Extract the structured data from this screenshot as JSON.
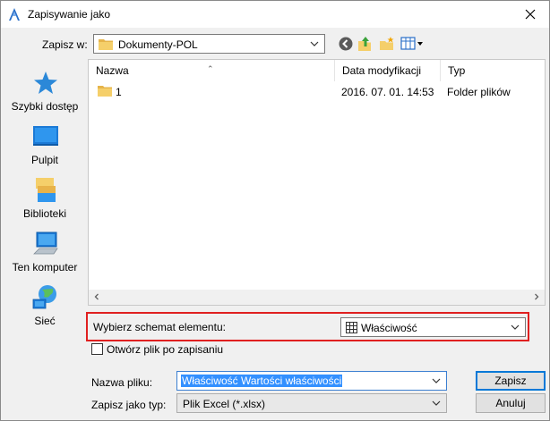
{
  "window": {
    "title": "Zapisywanie jako"
  },
  "toolbar": {
    "save_in_label": "Zapisz w:",
    "current_folder": "Dokumenty-POL"
  },
  "places": [
    {
      "label": "Szybki dostęp",
      "icon": "star-icon"
    },
    {
      "label": "Pulpit",
      "icon": "desktop-icon"
    },
    {
      "label": "Biblioteki",
      "icon": "libraries-icon"
    },
    {
      "label": "Ten komputer",
      "icon": "computer-icon"
    },
    {
      "label": "Sieć",
      "icon": "network-icon"
    }
  ],
  "file_list": {
    "columns": [
      "Nazwa",
      "Data modyfikacji",
      "Typ"
    ],
    "rows": [
      {
        "name": "1",
        "modified": "2016. 07. 01. 14:53",
        "type": "Folder plików"
      }
    ]
  },
  "schema": {
    "label": "Wybierz schemat elementu:",
    "selected": "Właściwość"
  },
  "open_after_save": {
    "label": "Otwórz plik po zapisaniu",
    "checked": false
  },
  "file_name": {
    "label": "Nazwa pliku:",
    "value": "Właściwość Wartości właściwości"
  },
  "file_type": {
    "label": "Zapisz jako typ:",
    "value": "Plik Excel (*.xlsx)"
  },
  "buttons": {
    "save": "Zapisz",
    "cancel": "Anuluj"
  },
  "colors": {
    "highlight_border": "#e02020",
    "selection": "#3390ff",
    "folder": "#f2c55c",
    "accent": "#0078d7"
  }
}
